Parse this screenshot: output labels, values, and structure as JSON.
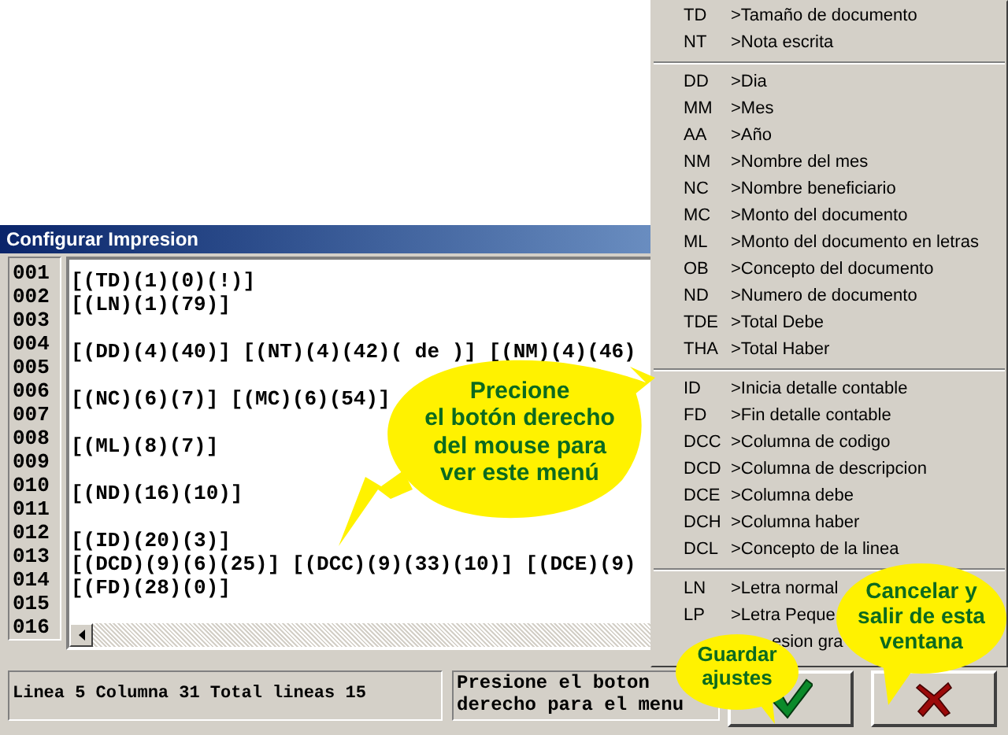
{
  "dialog": {
    "title": "Configurar Impresion",
    "lines": [
      {
        "number": "001",
        "text": "[(TD)(1)(0)(!)]"
      },
      {
        "number": "002",
        "text": "[(LN)(1)(79)]"
      },
      {
        "number": "003"
      },
      {
        "number": "004",
        "text": "[(DD)(4)(40)] [(NT)(4)(42)( de )] [(NM)(4)(46)"
      },
      {
        "number": "005"
      },
      {
        "number": "006",
        "text": "[(NC)(6)(7)] [(MC)(6)(54)]"
      },
      {
        "number": "007"
      },
      {
        "number": "008",
        "text": "[(ML)(8)(7)]"
      },
      {
        "number": "009"
      },
      {
        "number": "010",
        "text": "[(ND)(16)(10)]"
      },
      {
        "number": "011"
      },
      {
        "number": "012",
        "text": "[(ID)(20)(3)]"
      },
      {
        "number": "013",
        "text": "[(DCD)(9)(6)(25)] [(DCC)(9)(33)(10)] [(DCE)(9)"
      },
      {
        "number": "014",
        "text": "[(FD)(28)(0)]"
      },
      {
        "number": "015"
      },
      {
        "number": "016"
      }
    ],
    "status": {
      "position": "Linea 5 Columna 31 Total lineas 15",
      "hint": "Presione el boton derecho para el menu"
    }
  },
  "menu": [
    [
      {
        "code": "TD",
        "label": ">Tamaño de documento"
      },
      {
        "code": "NT",
        "label": ">Nota escrita"
      }
    ],
    [
      {
        "code": "DD",
        "label": ">Dia"
      },
      {
        "code": "MM",
        "label": ">Mes"
      },
      {
        "code": "AA",
        "label": ">Año"
      },
      {
        "code": "NM",
        "label": ">Nombre del mes"
      },
      {
        "code": "NC",
        "label": ">Nombre beneficiario"
      },
      {
        "code": "MC",
        "label": ">Monto del documento"
      },
      {
        "code": "ML",
        "label": ">Monto del documento en letras"
      },
      {
        "code": "OB",
        "label": ">Concepto del documento"
      },
      {
        "code": "ND",
        "label": ">Numero de documento"
      },
      {
        "code": "TDE",
        "label": ">Total Debe"
      },
      {
        "code": "THA",
        "label": ">Total Haber"
      }
    ],
    [
      {
        "code": "ID",
        "label": ">Inicia detalle contable"
      },
      {
        "code": "FD",
        "label": ">Fin detalle contable"
      },
      {
        "code": "DCC",
        "label": ">Columna de codigo"
      },
      {
        "code": "DCD",
        "label": ">Columna de descripcion"
      },
      {
        "code": "DCE",
        "label": ">Columna debe"
      },
      {
        "code": "DCH",
        "label": ">Columna haber"
      },
      {
        "code": "DCL",
        "label": ">Concepto de la linea"
      }
    ],
    [
      {
        "code": "LN",
        "label": ">Letra normal"
      },
      {
        "code": "LP",
        "label": ">Letra Peque"
      },
      {
        "label": "esion gra"
      }
    ]
  ],
  "callouts": [
    {
      "kind": "main",
      "lines": [
        "Precione",
        "el botón derecho",
        "del mouse para",
        "ver este menú"
      ]
    },
    {
      "kind": "save",
      "lines": [
        "Guardar",
        "ajustes"
      ]
    },
    {
      "kind": "cancel",
      "lines": [
        "Cancelar y",
        "salir de esta",
        "ventana"
      ]
    }
  ]
}
